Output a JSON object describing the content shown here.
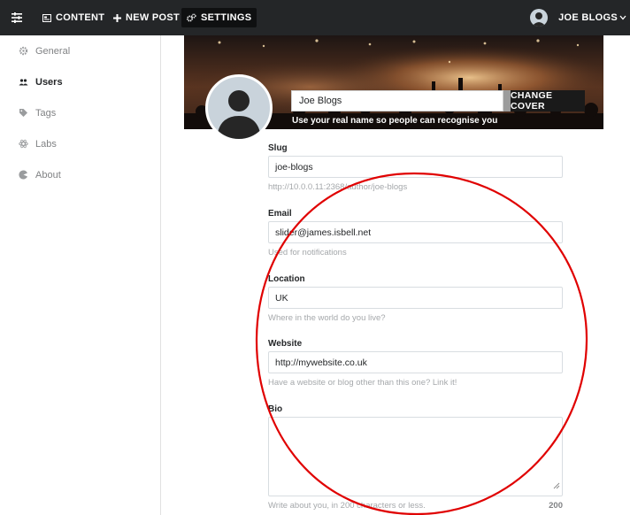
{
  "topbar": {
    "nav": [
      {
        "label": "CONTENT",
        "icon": "content-icon"
      },
      {
        "label": "NEW POST",
        "icon": "plus-icon"
      },
      {
        "label": "SETTINGS",
        "icon": "gears-icon"
      }
    ],
    "user": {
      "name": "JOE BLOGS"
    }
  },
  "sidebar": {
    "items": [
      {
        "label": "General",
        "icon": "gear-icon"
      },
      {
        "label": "Users",
        "icon": "users-icon"
      },
      {
        "label": "Tags",
        "icon": "tag-icon"
      },
      {
        "label": "Labs",
        "icon": "atom-icon"
      },
      {
        "label": "About",
        "icon": "pie-icon"
      }
    ],
    "active_index": 1
  },
  "profile": {
    "name": "Joe Blogs",
    "name_help": "Use your real name so people can recognise you",
    "change_cover": "CHANGE COVER"
  },
  "form": {
    "slug": {
      "label": "Slug",
      "value": "joe-blogs",
      "help": "http://10.0.0.11:2368/author/joe-blogs"
    },
    "email": {
      "label": "Email",
      "value": "slider@james.isbell.net",
      "help": "Used for notifications"
    },
    "location": {
      "label": "Location",
      "value": "UK",
      "help": "Where in the world do you live?"
    },
    "website": {
      "label": "Website",
      "value": "http://mywebsite.co.uk",
      "help": "Have a website or blog other than this one? Link it!"
    },
    "bio": {
      "label": "Bio",
      "value": "",
      "help": "Write about you, in 200 characters or less.",
      "count": "200"
    }
  },
  "colors": {
    "topbar": "#242628",
    "annotation": "#e00000",
    "help_text": "#a5a8ab"
  }
}
